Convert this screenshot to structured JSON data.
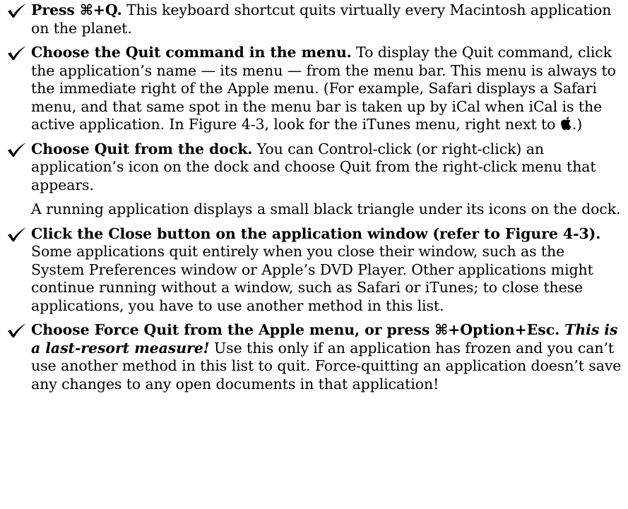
{
  "items": [
    {
      "lead": "Press ⌘+Q.",
      "text": " This keyboard shortcut quits virtually every Macintosh application on the planet."
    },
    {
      "lead": "Choose the Quit command in the menu.",
      "text": " To display the Quit command, click the application’s name — its menu — from the menu bar. This menu is always to the immediate right of the Apple menu. (For example, Safari displays a Safari menu, and that same spot in the menu bar is taken up by iCal when iCal is the active application. In Figure 4-3, look for the iTunes menu, right next to ",
      "text_after_icon": ".)"
    },
    {
      "lead": "Choose Quit from the dock.",
      "text": " You can Control-click (or right-click) an application’s icon on the dock and choose Quit from the right-click menu that appears."
    },
    {
      "note": "A running application displays a small black triangle under its icons on the dock."
    },
    {
      "lead": "Click the Close button on the application window (refer to Figure 4-3).",
      "text": " Some applications quit entirely when you close their window, such as the System Preferences window or Apple’s DVD Player. Other applications might continue running without a window, such as Safari or iTunes; to close these applications, you have to use another method in this list."
    },
    {
      "lead": "Choose Force Quit from the Apple menu, or press ⌘+Option+Esc.",
      "emphasis": " This is a last-resort measure!",
      "text": " Use this only if an application has frozen and you can’t use another method in this list to quit. Force-quitting an application doesn’t save any changes to any open documents in that application!"
    }
  ],
  "icons": {
    "bullet": "check-mark-icon",
    "inline": "apple-logo-icon"
  }
}
